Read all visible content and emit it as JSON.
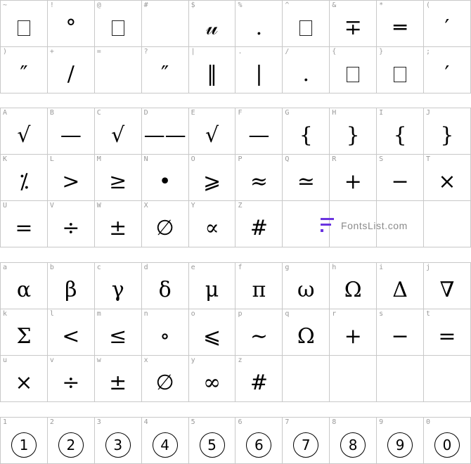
{
  "brand": {
    "watermark_text": "FontsList.com",
    "accent": "#6a34e0"
  },
  "sections": [
    {
      "rows": [
        [
          {
            "key": "~",
            "glyph": "",
            "box": true
          },
          {
            "key": "!",
            "glyph": "°"
          },
          {
            "key": "@",
            "glyph": "",
            "box": true
          },
          {
            "key": "#",
            "glyph": ""
          },
          {
            "key": "$",
            "glyph": "𝓊"
          },
          {
            "key": "%",
            "glyph": "."
          },
          {
            "key": "^",
            "glyph": "",
            "box": true
          },
          {
            "key": "&",
            "glyph": "∓"
          },
          {
            "key": "*",
            "glyph": "═"
          },
          {
            "key": "(",
            "glyph": "′"
          }
        ],
        [
          {
            "key": ")",
            "glyph": "″"
          },
          {
            "key": "+",
            "glyph": "∕"
          },
          {
            "key": "=",
            "glyph": ""
          },
          {
            "key": "?",
            "glyph": "″"
          },
          {
            "key": "|",
            "glyph": "‖"
          },
          {
            "key": ".",
            "glyph": "|"
          },
          {
            "key": "/",
            "glyph": "."
          },
          {
            "key": "{",
            "glyph": "",
            "box": true
          },
          {
            "key": "}",
            "glyph": "",
            "box": true
          },
          {
            "key": ";",
            "glyph": "′"
          }
        ]
      ]
    },
    {
      "rows": [
        [
          {
            "key": "A",
            "glyph": "√"
          },
          {
            "key": "B",
            "glyph": "—"
          },
          {
            "key": "C",
            "glyph": "√"
          },
          {
            "key": "D",
            "glyph": "——"
          },
          {
            "key": "E",
            "glyph": "√"
          },
          {
            "key": "F",
            "glyph": "—"
          },
          {
            "key": "G",
            "glyph": "{"
          },
          {
            "key": "H",
            "glyph": "}"
          },
          {
            "key": "I",
            "glyph": "{"
          },
          {
            "key": "J",
            "glyph": "}"
          }
        ],
        [
          {
            "key": "K",
            "glyph": "⁒"
          },
          {
            "key": "L",
            "glyph": ">"
          },
          {
            "key": "M",
            "glyph": "≥"
          },
          {
            "key": "N",
            "glyph": "•"
          },
          {
            "key": "O",
            "glyph": "⩾"
          },
          {
            "key": "P",
            "glyph": "≈"
          },
          {
            "key": "Q",
            "glyph": "≃"
          },
          {
            "key": "R",
            "glyph": "+"
          },
          {
            "key": "S",
            "glyph": "−"
          },
          {
            "key": "T",
            "glyph": "×"
          }
        ],
        [
          {
            "key": "U",
            "glyph": "="
          },
          {
            "key": "V",
            "glyph": "÷"
          },
          {
            "key": "W",
            "glyph": "±"
          },
          {
            "key": "X",
            "glyph": "∅"
          },
          {
            "key": "Y",
            "glyph": "∝"
          },
          {
            "key": "Z",
            "glyph": "#"
          },
          {
            "key": "",
            "glyph": ""
          },
          {
            "key": "",
            "glyph": ""
          },
          {
            "key": "",
            "glyph": ""
          },
          {
            "key": "",
            "glyph": ""
          }
        ]
      ]
    },
    {
      "rows": [
        [
          {
            "key": "a",
            "glyph": "α"
          },
          {
            "key": "b",
            "glyph": "β"
          },
          {
            "key": "c",
            "glyph": "γ"
          },
          {
            "key": "d",
            "glyph": "δ"
          },
          {
            "key": "e",
            "glyph": "μ"
          },
          {
            "key": "f",
            "glyph": "π"
          },
          {
            "key": "g",
            "glyph": "ω"
          },
          {
            "key": "h",
            "glyph": "Ω"
          },
          {
            "key": "i",
            "glyph": "Δ"
          },
          {
            "key": "j",
            "glyph": "∇"
          }
        ],
        [
          {
            "key": "k",
            "glyph": "Σ"
          },
          {
            "key": "l",
            "glyph": "<"
          },
          {
            "key": "m",
            "glyph": "≤"
          },
          {
            "key": "n",
            "glyph": "∘"
          },
          {
            "key": "o",
            "glyph": "⩽"
          },
          {
            "key": "p",
            "glyph": "∼"
          },
          {
            "key": "q",
            "glyph": "Ω"
          },
          {
            "key": "r",
            "glyph": "+"
          },
          {
            "key": "s",
            "glyph": "−"
          },
          {
            "key": "t",
            "glyph": "="
          }
        ],
        [
          {
            "key": "u",
            "glyph": "×"
          },
          {
            "key": "v",
            "glyph": "÷"
          },
          {
            "key": "w",
            "glyph": "±"
          },
          {
            "key": "x",
            "glyph": "∅"
          },
          {
            "key": "y",
            "glyph": "∞"
          },
          {
            "key": "z",
            "glyph": "#"
          },
          {
            "key": "",
            "glyph": ""
          },
          {
            "key": "",
            "glyph": ""
          },
          {
            "key": "",
            "glyph": ""
          },
          {
            "key": "",
            "glyph": ""
          }
        ]
      ]
    },
    {
      "circled": true,
      "rows": [
        [
          {
            "key": "1",
            "glyph": "1"
          },
          {
            "key": "2",
            "glyph": "2"
          },
          {
            "key": "3",
            "glyph": "3"
          },
          {
            "key": "4",
            "glyph": "4"
          },
          {
            "key": "5",
            "glyph": "5"
          },
          {
            "key": "6",
            "glyph": "6"
          },
          {
            "key": "7",
            "glyph": "7"
          },
          {
            "key": "8",
            "glyph": "8"
          },
          {
            "key": "9",
            "glyph": "9"
          },
          {
            "key": "0",
            "glyph": "0"
          }
        ]
      ]
    }
  ]
}
